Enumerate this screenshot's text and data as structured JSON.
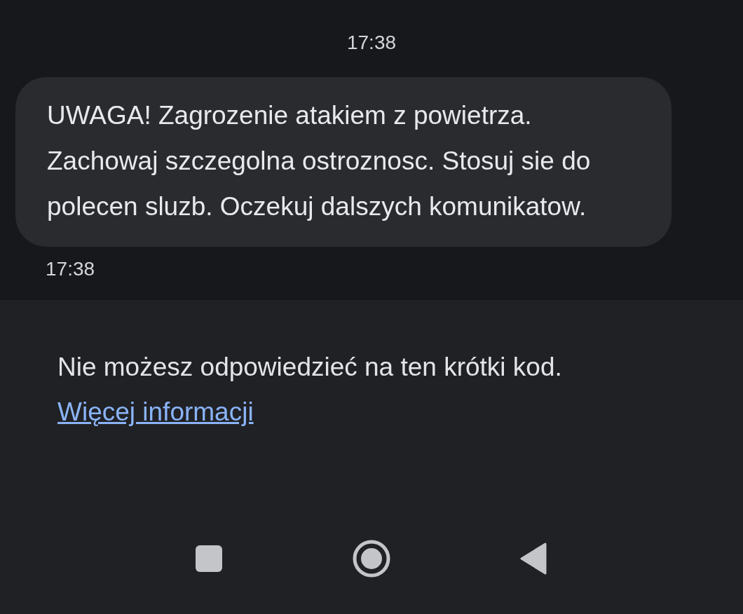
{
  "conversation": {
    "date_time": "17:38",
    "messages": [
      {
        "text": "UWAGA! Zagrozenie atakiem z powietrza. Zachowaj szczegolna ostroznosc. Stosuj sie do polecen sluzb. Oczekuj dalszych komunikatow.",
        "time": "17:38"
      }
    ]
  },
  "reply_notice": {
    "text": "Nie możesz odpowiedzieć na ten krótki kod.",
    "link": "Więcej informacji"
  }
}
